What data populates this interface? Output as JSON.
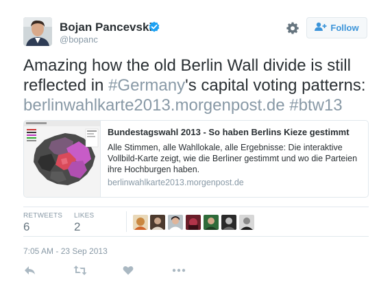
{
  "author": {
    "name": "Bojan Pancevski",
    "handle": "@bopanc",
    "verified": true,
    "avatar_icon": "profile-photo"
  },
  "follow_button": {
    "label": "Follow",
    "icon": "add-user-icon"
  },
  "settings_icon": "gear-icon",
  "tweet": {
    "text_part1": "Amazing how the old Berlin Wall divide is still reflected in ",
    "hashtag1": "#Germany",
    "text_part2": "'s capital voting patterns: ",
    "link": "berlinwahlkarte2013.morgenpost.de",
    "hashtag2": "#btw13"
  },
  "card": {
    "title": "Bundestagswahl 2013 - So haben Berlins Kieze gestimmt",
    "description": "Alle Stimmen, alle Wahllokale, alle Ergebnisse: Die interaktive Vollbild-Karte zeigt, wie die Berliner gestimmt und wo die Parteien ihre Hochburgen haben.",
    "url": "berlinwahlkarte2013.morgenpost.de",
    "thumbnail_icon": "berlin-map-thumbnail"
  },
  "stats": {
    "retweets_label": "RETWEETS",
    "retweets_value": "6",
    "likes_label": "LIKES",
    "likes_value": "2"
  },
  "timestamp": "7:05 AM - 23 Sep 2013",
  "actions": [
    "reply-icon",
    "retweet-icon",
    "like-icon",
    "more-icon"
  ],
  "colors": {
    "text": "#292f33",
    "muted": "#8899a6",
    "accent": "#3b94d9",
    "verified": "#1da1f2",
    "border": "#e1e8ed"
  }
}
